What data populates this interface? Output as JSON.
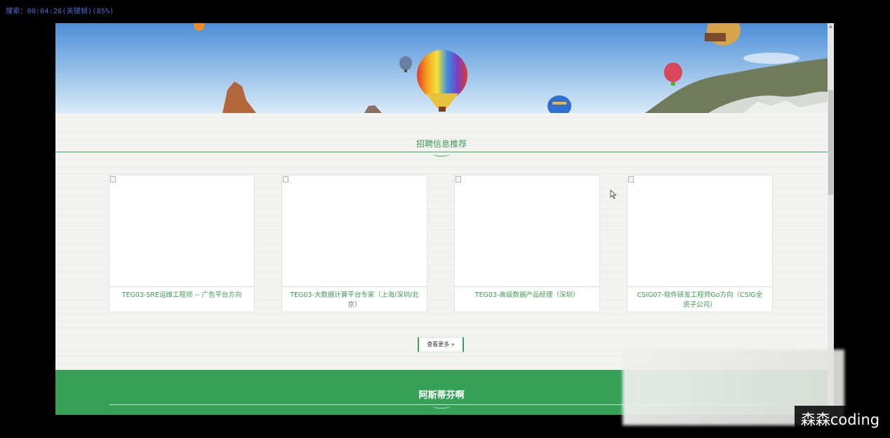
{
  "recording": {
    "timer_text": "搜索：00:04:26(关键帧)(85%)"
  },
  "section": {
    "title": "招聘信息推荐"
  },
  "jobs": [
    {
      "title": "TEG03-SRE运维工程师 -- 广告平台方向"
    },
    {
      "title": "TEG03-大数据计算平台专家（上海/深圳/北京）"
    },
    {
      "title": "TEG03-高级数据产品经理（深圳）"
    },
    {
      "title": "CSIG07-软件研发工程师Go方向（CSIG全资子公司）"
    }
  ],
  "more_button": {
    "label": "查看更多 »"
  },
  "green_section": {
    "title": "阿斯蒂芬啊"
  },
  "watermark": {
    "text": "森森coding"
  },
  "colors": {
    "accent": "#35a157",
    "link": "#3f9b55"
  }
}
